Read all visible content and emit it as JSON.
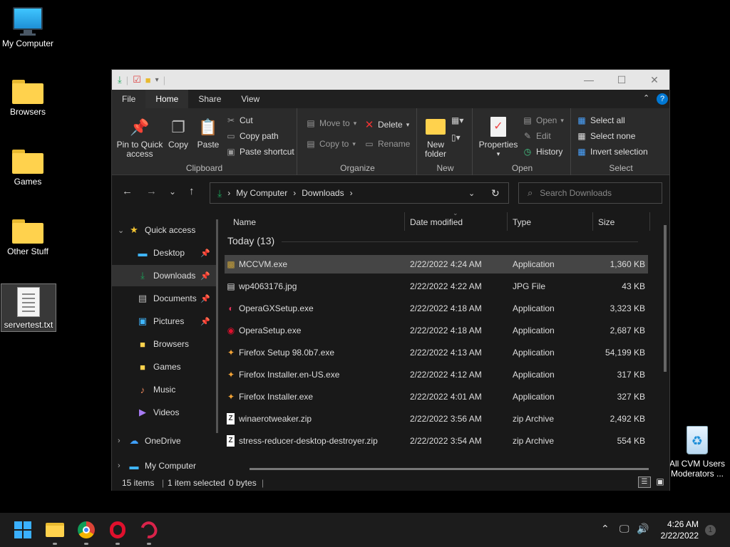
{
  "desktop": {
    "icons": [
      {
        "label": "My Computer",
        "icon": "monitor-icon"
      },
      {
        "label": "Browsers",
        "icon": "folder-icon"
      },
      {
        "label": "Games",
        "icon": "folder-icon"
      },
      {
        "label": "Other Stuff",
        "icon": "folder-icon"
      },
      {
        "label": "servertest.txt",
        "icon": "text-file-icon"
      }
    ],
    "recycle_bin": {
      "line1": "All CVM Users",
      "line2": "Moderators ..."
    }
  },
  "window": {
    "title_controls": {
      "minimize": "—",
      "maximize": "☐",
      "close": "✕"
    },
    "ribbon_tabs": [
      "File",
      "Home",
      "Share",
      "View"
    ],
    "ribbon": {
      "clipboard": {
        "label": "Clipboard",
        "pin": "Pin to Quick access",
        "copy": "Copy",
        "paste": "Paste",
        "cut": "Cut",
        "copy_path": "Copy path",
        "paste_shortcut": "Paste shortcut"
      },
      "organize": {
        "label": "Organize",
        "move_to": "Move to",
        "copy_to": "Copy to",
        "delete": "Delete",
        "rename": "Rename"
      },
      "new": {
        "label": "New",
        "new_folder": "New folder"
      },
      "open": {
        "label": "Open",
        "properties": "Properties",
        "open": "Open",
        "edit": "Edit",
        "history": "History"
      },
      "select": {
        "label": "Select",
        "select_all": "Select all",
        "select_none": "Select none",
        "invert": "Invert selection"
      }
    },
    "address": {
      "crumbs": [
        "My Computer",
        "Downloads"
      ]
    },
    "search": {
      "placeholder": "Search Downloads"
    },
    "nav_pane": [
      {
        "label": "Quick access",
        "icon": "star-icon",
        "pinned": false
      },
      {
        "label": "Desktop",
        "icon": "desktop-icon",
        "pinned": true
      },
      {
        "label": "Downloads",
        "icon": "download-icon",
        "pinned": true
      },
      {
        "label": "Documents",
        "icon": "document-icon",
        "pinned": true
      },
      {
        "label": "Pictures",
        "icon": "pictures-icon",
        "pinned": true
      },
      {
        "label": "Browsers",
        "icon": "folder-icon",
        "pinned": false
      },
      {
        "label": "Games",
        "icon": "folder-icon",
        "pinned": false
      },
      {
        "label": "Music",
        "icon": "music-icon",
        "pinned": false
      },
      {
        "label": "Videos",
        "icon": "video-icon",
        "pinned": false
      },
      {
        "label": "OneDrive",
        "icon": "cloud-icon",
        "pinned": false
      },
      {
        "label": "My Computer",
        "icon": "computer-icon",
        "pinned": false
      }
    ],
    "columns": {
      "name": "Name",
      "date": "Date modified",
      "type": "Type",
      "size": "Size"
    },
    "group": "Today (13)",
    "files": [
      {
        "name": "MCCVM.exe",
        "date": "2/22/2022 4:24 AM",
        "type": "Application",
        "size": "1,360 KB",
        "icon": "exe-icon",
        "selected": true
      },
      {
        "name": "wp4063176.jpg",
        "date": "2/22/2022 4:22 AM",
        "type": "JPG File",
        "size": "43 KB",
        "icon": "image-file-icon",
        "selected": false
      },
      {
        "name": "OperaGXSetup.exe",
        "date": "2/22/2022 4:18 AM",
        "type": "Application",
        "size": "3,323 KB",
        "icon": "operagx-icon",
        "selected": false
      },
      {
        "name": "OperaSetup.exe",
        "date": "2/22/2022 4:18 AM",
        "type": "Application",
        "size": "2,687 KB",
        "icon": "opera-setup-icon",
        "selected": false
      },
      {
        "name": "Firefox Setup 98.0b7.exe",
        "date": "2/22/2022 4:13 AM",
        "type": "Application",
        "size": "54,199 KB",
        "icon": "firefox-setup-icon",
        "selected": false
      },
      {
        "name": "Firefox Installer.en-US.exe",
        "date": "2/22/2022 4:12 AM",
        "type": "Application",
        "size": "317 KB",
        "icon": "firefox-setup-icon",
        "selected": false
      },
      {
        "name": "Firefox Installer.exe",
        "date": "2/22/2022 4:01 AM",
        "type": "Application",
        "size": "327 KB",
        "icon": "firefox-setup-icon",
        "selected": false
      },
      {
        "name": "winaerotweaker.zip",
        "date": "2/22/2022 3:56 AM",
        "type": "zip Archive",
        "size": "2,492 KB",
        "icon": "zip-icon",
        "selected": false
      },
      {
        "name": "stress-reducer-desktop-destroyer.zip",
        "date": "2/22/2022 3:54 AM",
        "type": "zip Archive",
        "size": "554 KB",
        "icon": "zip-icon",
        "selected": false
      }
    ],
    "status": {
      "count": "15 items",
      "selected": "1 item selected",
      "bytes": "0 bytes"
    }
  },
  "taskbar": {
    "time": "4:26 AM",
    "date": "2/22/2022",
    "notifications": "1"
  },
  "colors": {
    "accent": "#0078d4",
    "folder": "#ffd24d",
    "selection": "#454545"
  }
}
